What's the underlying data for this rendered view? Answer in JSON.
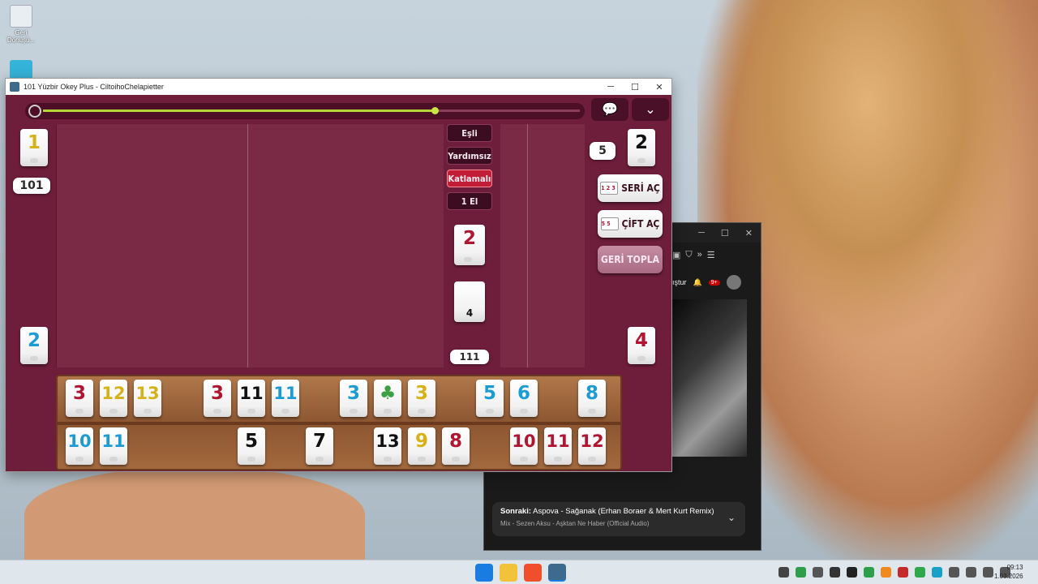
{
  "desktop": {
    "icons": [
      {
        "label": "Geri Dönüşü...",
        "color": "#e9eef2"
      },
      {
        "label": "",
        "color": "#36b3d9"
      }
    ]
  },
  "window": {
    "title": "101 Yüzbir Okey Plus - CiltoihoChelapietter",
    "minimize": "─",
    "maximize": "☐",
    "close": "✕"
  },
  "game": {
    "timer_progress": 0.73,
    "chat_icon": "chat-bubble-icon",
    "menu_icon": "chevron-down-icon",
    "options": [
      "Eşli",
      "Yardımsız",
      "Katlamalı",
      "1 El"
    ],
    "active_option": "Katlamalı",
    "indicator_tile": {
      "value": "2",
      "color": "red"
    },
    "deck_tile": {
      "value": "4"
    },
    "deck_count": "111",
    "left_top_tile": {
      "value": "1",
      "color": "yellow"
    },
    "left_score": "101",
    "left_bottom_tile": {
      "value": "2",
      "color": "blue"
    },
    "right_top_tile": {
      "value": "2",
      "color": "black"
    },
    "right_count": "5",
    "right_bottom_tile": {
      "value": "4",
      "color": "red"
    },
    "buttons": {
      "seri_ac": "SERİ AÇ",
      "cift_ac": "ÇİFT AÇ",
      "geri_topla": "GERİ TOPLA",
      "seri_icon": "1 2 3",
      "cift_icon": "5 5"
    },
    "rack_top": [
      {
        "value": "3",
        "color": "red"
      },
      {
        "value": "12",
        "color": "yellow"
      },
      {
        "value": "13",
        "color": "yellow"
      },
      {
        "value": "3",
        "color": "red"
      },
      {
        "value": "11",
        "color": "black"
      },
      {
        "value": "11",
        "color": "blue"
      },
      {
        "value": "3",
        "color": "blue"
      },
      {
        "value": "♣",
        "color": "green"
      },
      {
        "value": "3",
        "color": "yellow"
      },
      {
        "value": "5",
        "color": "blue"
      },
      {
        "value": "6",
        "color": "blue"
      },
      {
        "value": "8",
        "color": "blue"
      }
    ],
    "rack_bottom": [
      {
        "value": "10",
        "color": "blue"
      },
      {
        "value": "11",
        "color": "blue"
      },
      {
        "value": "5",
        "color": "black"
      },
      {
        "value": "7",
        "color": "black"
      },
      {
        "value": "13",
        "color": "black"
      },
      {
        "value": "9",
        "color": "yellow"
      },
      {
        "value": "8",
        "color": "red"
      },
      {
        "value": "10",
        "color": "red"
      },
      {
        "value": "11",
        "color": "red"
      },
      {
        "value": "12",
        "color": "red"
      }
    ]
  },
  "browser": {
    "search_fragment": "ıştur",
    "notification_count": "9+",
    "next_label": "Sonraki:",
    "next_title": "Aspova - Sağanak (Erhan Boraer & Mert Kurt Remix)",
    "mix_title": "Mix - Sezen Aksu - Aşktan Ne Haber (Official Audio)"
  },
  "taskbar": {
    "time": "09:13",
    "date": "1.03.2026",
    "apps": [
      "windows-start-icon",
      "file-explorer-icon",
      "brave-browser-icon",
      "okey-game-icon"
    ]
  },
  "colors": {
    "red": "#b01531",
    "yellow": "#d6b21a",
    "blue": "#1d9bd3",
    "black": "#111111",
    "green": "#3aa043",
    "table": "#6e1e3a"
  }
}
